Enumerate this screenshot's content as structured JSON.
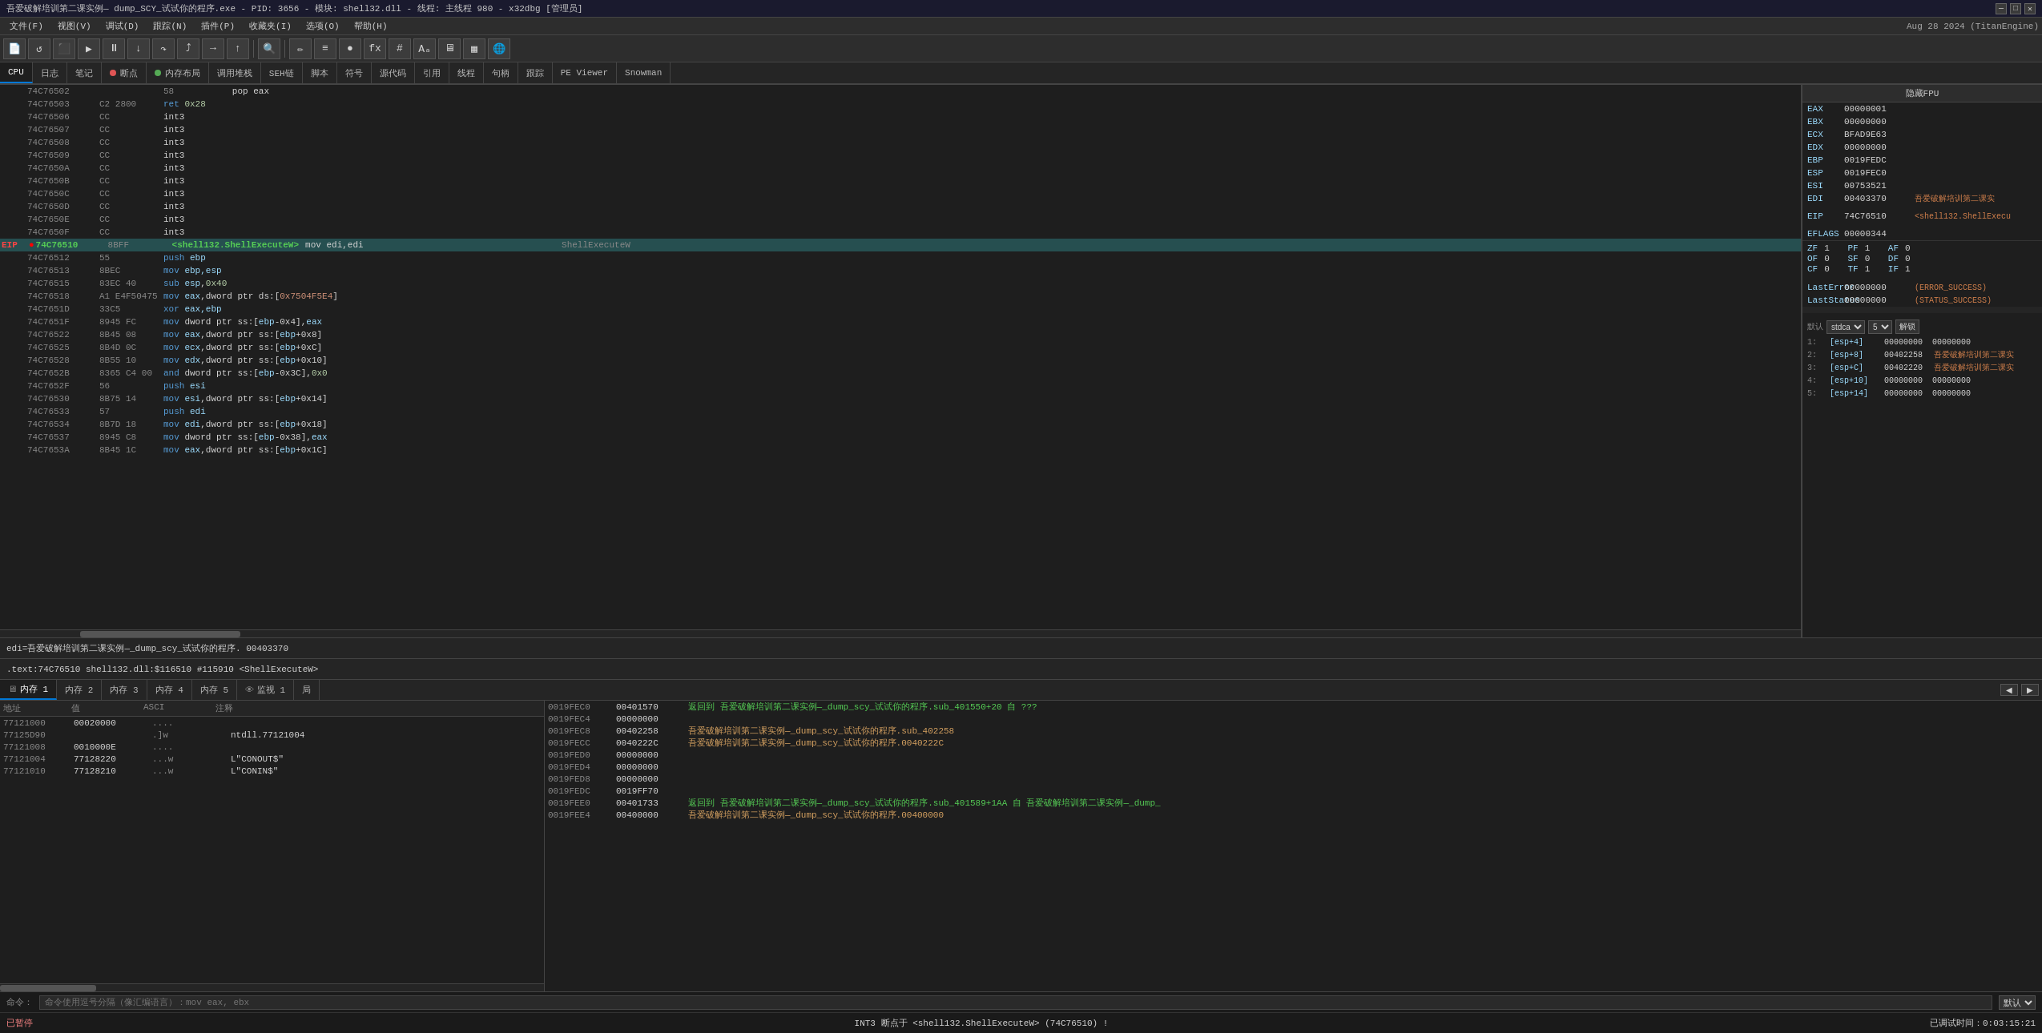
{
  "titlebar": {
    "title": "吾爱破解培训第二课实例— dump_SCY_试试你的程序.exe - PID: 3656 - 模块: shell32.dll - 线程: 主线程 980 - x32dbg [管理员]",
    "minimize": "—",
    "maximize": "□",
    "close": "✕"
  },
  "menubar": {
    "items": [
      "文件(F)",
      "视图(V)",
      "调试(D)",
      "跟踪(N)",
      "插件(P)",
      "收藏夹(I)",
      "选项(O)",
      "帮助(H)"
    ],
    "date": "Aug 28 2024 (TitanEngine)"
  },
  "tabs": [
    {
      "label": "CPU",
      "active": true,
      "dot": ""
    },
    {
      "label": "日志",
      "active": false,
      "dot": ""
    },
    {
      "label": "笔记",
      "active": false,
      "dot": ""
    },
    {
      "label": "断点",
      "active": false,
      "dot": "red"
    },
    {
      "label": "内存布局",
      "active": false,
      "dot": "green"
    },
    {
      "label": "调用堆栈",
      "active": false,
      "dot": ""
    },
    {
      "label": "SEH链",
      "active": false,
      "dot": ""
    },
    {
      "label": "脚本",
      "active": false,
      "dot": ""
    },
    {
      "label": "符号",
      "active": false,
      "dot": ""
    },
    {
      "label": "源代码",
      "active": false,
      "dot": ""
    },
    {
      "label": "引用",
      "active": false,
      "dot": ""
    },
    {
      "label": "线程",
      "active": false,
      "dot": ""
    },
    {
      "label": "句柄",
      "active": false,
      "dot": ""
    },
    {
      "label": "跟踪",
      "active": false,
      "dot": ""
    },
    {
      "label": "PE Viewer",
      "active": false,
      "dot": ""
    },
    {
      "label": "Snowman",
      "active": false,
      "dot": ""
    }
  ],
  "registers": {
    "title": "隐藏FPU",
    "regs": [
      {
        "name": "EAX",
        "val": "00000001",
        "comment": ""
      },
      {
        "name": "EBX",
        "val": "00000000",
        "comment": ""
      },
      {
        "name": "ECX",
        "val": "BFAD9E63",
        "comment": ""
      },
      {
        "name": "EDX",
        "val": "00000000",
        "comment": ""
      },
      {
        "name": "EBP",
        "val": "0019FEDC",
        "comment": ""
      },
      {
        "name": "ESP",
        "val": "0019FEC0",
        "comment": ""
      },
      {
        "name": "ESI",
        "val": "00753521",
        "comment": ""
      },
      {
        "name": "EDI",
        "val": "00403370",
        "comment": "吾爱破解培训第二课实"
      }
    ],
    "eip": {
      "name": "EIP",
      "val": "74C76510",
      "comment": "<shell32.ShellExecu"
    },
    "eflags": {
      "name": "EFLAGS",
      "val": "00000344"
    },
    "flags": [
      {
        "name": "ZF",
        "val": "1",
        "name2": "PF",
        "val2": "1",
        "name3": "AF",
        "val3": "0"
      },
      {
        "name": "OF",
        "val": "0",
        "name2": "SF",
        "val2": "0",
        "name3": "DF",
        "val3": "0"
      },
      {
        "name": "CF",
        "val": "0",
        "name2": "TF",
        "val2": "1",
        "name3": "IF",
        "val3": "1"
      }
    ],
    "lasterror": {
      "name": "LastError",
      "val": "00000000",
      "comment": "(ERROR_SUCCESS)"
    },
    "laststatus": {
      "name": "LastStatus",
      "val": "00000000",
      "comment": "(STATUS_SUCCESS)"
    },
    "call_conv": "默认 (stdca",
    "call_num": "5",
    "stack_args": [
      {
        "num": "1:",
        "addr": "[esp+4]",
        "val": "00000000",
        "val2": "00000000"
      },
      {
        "num": "2:",
        "addr": "[esp+8]",
        "val": "00402258",
        "val2": "吾爱破解培训第二课实"
      },
      {
        "num": "3:",
        "addr": "[esp+C]",
        "val": "00402220",
        "val2": "吾爱破解培训第二课实"
      },
      {
        "num": "4:",
        "addr": "[esp+10]",
        "val": "00000000",
        "val2": "00000000"
      },
      {
        "num": "5:",
        "addr": "[esp+14]",
        "val": "00000000",
        "val2": "00000000"
      }
    ]
  },
  "disasm": {
    "rows": [
      {
        "addr": "74C76502",
        "bytes": "",
        "mnem": "58",
        "op": "pop eax",
        "comment": ""
      },
      {
        "addr": "74C76503",
        "bytes": "C2 2800",
        "mnem": "",
        "op": "ret 0x28",
        "comment": ""
      },
      {
        "addr": "74C76506",
        "bytes": "CC",
        "mnem": "",
        "op": "int3",
        "comment": ""
      },
      {
        "addr": "74C76507",
        "bytes": "CC",
        "mnem": "",
        "op": "int3",
        "comment": ""
      },
      {
        "addr": "74C76508",
        "bytes": "CC",
        "mnem": "",
        "op": "int3",
        "comment": ""
      },
      {
        "addr": "74C76509",
        "bytes": "CC",
        "mnem": "",
        "op": "int3",
        "comment": ""
      },
      {
        "addr": "74C7650A",
        "bytes": "CC",
        "mnem": "",
        "op": "int3",
        "comment": ""
      },
      {
        "addr": "74C7650B",
        "bytes": "CC",
        "mnem": "",
        "op": "int3",
        "comment": ""
      },
      {
        "addr": "74C7650C",
        "bytes": "CC",
        "mnem": "",
        "op": "int3",
        "comment": ""
      },
      {
        "addr": "74C7650D",
        "bytes": "CC",
        "mnem": "",
        "op": "int3",
        "comment": ""
      },
      {
        "addr": "74C7650E",
        "bytes": "CC",
        "mnem": "",
        "op": "int3",
        "comment": ""
      },
      {
        "addr": "74C7650F",
        "bytes": "CC",
        "mnem": "",
        "op": "int3",
        "comment": ""
      },
      {
        "addr": "74C76510",
        "bytes": "8BFF",
        "mnem": "<shell132.ShellExecuteW>",
        "op": "mov edi,edi",
        "comment": "ShellExecuteW",
        "eip": true,
        "selected": true
      },
      {
        "addr": "74C76512",
        "bytes": "55",
        "mnem": "",
        "op": "push ebp",
        "comment": ""
      },
      {
        "addr": "74C76513",
        "bytes": "8BEC",
        "mnem": "",
        "op": "mov ebp,esp",
        "comment": ""
      },
      {
        "addr": "74C76515",
        "bytes": "83EC 40",
        "mnem": "",
        "op": "sub esp,0x40",
        "comment": ""
      },
      {
        "addr": "74C76518",
        "bytes": "A1 E4F50475",
        "mnem": "",
        "op": "mov eax,dword ptr ds:[0x7504F5E4]",
        "comment": ""
      },
      {
        "addr": "74C7651D",
        "bytes": "33C5",
        "mnem": "",
        "op": "xor eax,ebp",
        "comment": ""
      },
      {
        "addr": "74C7651F",
        "bytes": "8945 FC",
        "mnem": "",
        "op": "mov dword ptr ss:[ebp-0x4],eax",
        "comment": ""
      },
      {
        "addr": "74C76522",
        "bytes": "8B45 08",
        "mnem": "",
        "op": "mov eax,dword ptr ss:[ebp+0x8]",
        "comment": ""
      },
      {
        "addr": "74C76525",
        "bytes": "8B4D 0C",
        "mnem": "",
        "op": "mov ecx,dword ptr ss:[ebp+0xC]",
        "comment": ""
      },
      {
        "addr": "74C76528",
        "bytes": "8B55 10",
        "mnem": "",
        "op": "mov edx,dword ptr ss:[ebp+0x10]",
        "comment": ""
      },
      {
        "addr": "74C7652B",
        "bytes": "8365 C4 00",
        "mnem": "",
        "op": "and dword ptr ss:[ebp-0x3C],0x0",
        "comment": ""
      },
      {
        "addr": "74C7652F",
        "bytes": "56",
        "mnem": "",
        "op": "push esi",
        "comment": ""
      },
      {
        "addr": "74C76530",
        "bytes": "8B75 14",
        "mnem": "",
        "op": "mov esi,dword ptr ss:[ebp+0x14]",
        "comment": ""
      },
      {
        "addr": "74C76533",
        "bytes": "57",
        "mnem": "",
        "op": "push edi",
        "comment": ""
      },
      {
        "addr": "74C76534",
        "bytes": "8B7D 18",
        "mnem": "",
        "op": "mov edi,dword ptr ss:[ebp+0x18]",
        "comment": ""
      },
      {
        "addr": "74C76537",
        "bytes": "8945 C8",
        "mnem": "",
        "op": "mov dword ptr ss:[ebp-0x38],eax",
        "comment": ""
      },
      {
        "addr": "74C7653A",
        "bytes": "8B45 1C",
        "mnem": "",
        "op": "mov eax,dword ptr ss:[ebp+0x1C]",
        "comment": ""
      }
    ]
  },
  "status1": {
    "text": "edi=吾爱破解培训第二课实例—_dump_scy_试试你的程序. 00403370"
  },
  "status2": {
    "text": ".text:74C76510 shell132.dll:$116510 #115910 <ShellExecuteW>"
  },
  "mem_tabs": [
    {
      "label": "内存 1",
      "active": true
    },
    {
      "label": "内存 2",
      "active": false
    },
    {
      "label": "内存 3",
      "active": false
    },
    {
      "label": "内存 4",
      "active": false
    },
    {
      "label": "内存 5",
      "active": false
    },
    {
      "label": "监视 1",
      "active": false
    },
    {
      "label": "局",
      "active": false
    }
  ],
  "mem_dump": {
    "headers": [
      "地址",
      "值",
      "ASCI",
      "注释"
    ],
    "rows": [
      {
        "addr": "77121000",
        "val": "00020000",
        "ascii": "....",
        "note": ""
      },
      {
        "addr": "77125D90",
        "val": "",
        "ascii": ".]w",
        "note": "ntdll.77121004"
      },
      {
        "addr": "77121008",
        "val": "0010000E",
        "ascii": "....",
        "note": ""
      },
      {
        "addr": "77121004",
        "val": "77128220",
        "ascii": "...w",
        "note": "L\"CONOUT$\""
      },
      {
        "addr": "77121010",
        "val": "77128220",
        "ascii": "...w",
        "note": "L\"CONIN$\""
      }
    ]
  },
  "stack_panel": {
    "rows": [
      {
        "addr": "0019FEC0",
        "val": "00401570",
        "comment": "返回到 吾爱破解培训第二课实例—_dump_scy_试试你的程序.sub_401550+20 自 ???",
        "green": true
      },
      {
        "addr": "0019FEC4",
        "val": "00000000",
        "comment": ""
      },
      {
        "addr": "0019FEC8",
        "val": "00402258",
        "comment": "吾爱破解培训第二课实例—_dump_scy_试试你的程序.sub_402258"
      },
      {
        "addr": "0019FECC",
        "val": "0040222C",
        "comment": "吾爱破解培训第二课实例—_dump_scy_试试你的程序.0040222C"
      },
      {
        "addr": "0019FED0",
        "val": "00000000",
        "comment": ""
      },
      {
        "addr": "0019FED4",
        "val": "00000000",
        "comment": ""
      },
      {
        "addr": "0019FED8",
        "val": "00000000",
        "comment": ""
      },
      {
        "addr": "0019FEDC",
        "val": "0019FF70",
        "comment": ""
      },
      {
        "addr": "0019FEE0",
        "val": "00401733",
        "comment": "返回到 吾爱破解培训第二课实例—_dump_scy_试试你的程序.sub_401589+1AA 自 吾爱破解培训第二课实例—_dump_",
        "green": true
      },
      {
        "addr": "0019FEE4",
        "val": "00400000",
        "comment": "吾爱破解培训第二课实例—_dump_scy_试试你的程序.00400000"
      }
    ]
  },
  "bottombar": {
    "command_label": "命令：",
    "command_hint": "命令使用逗号分隔（像汇编语言）：mov eax, ebx",
    "status": "默认",
    "paused": "已暂停",
    "breakpoint": "INT3 断点于 <shell132.ShellExecuteW> (74C76510) !",
    "time": "已调试时间：0:03:15:21"
  }
}
